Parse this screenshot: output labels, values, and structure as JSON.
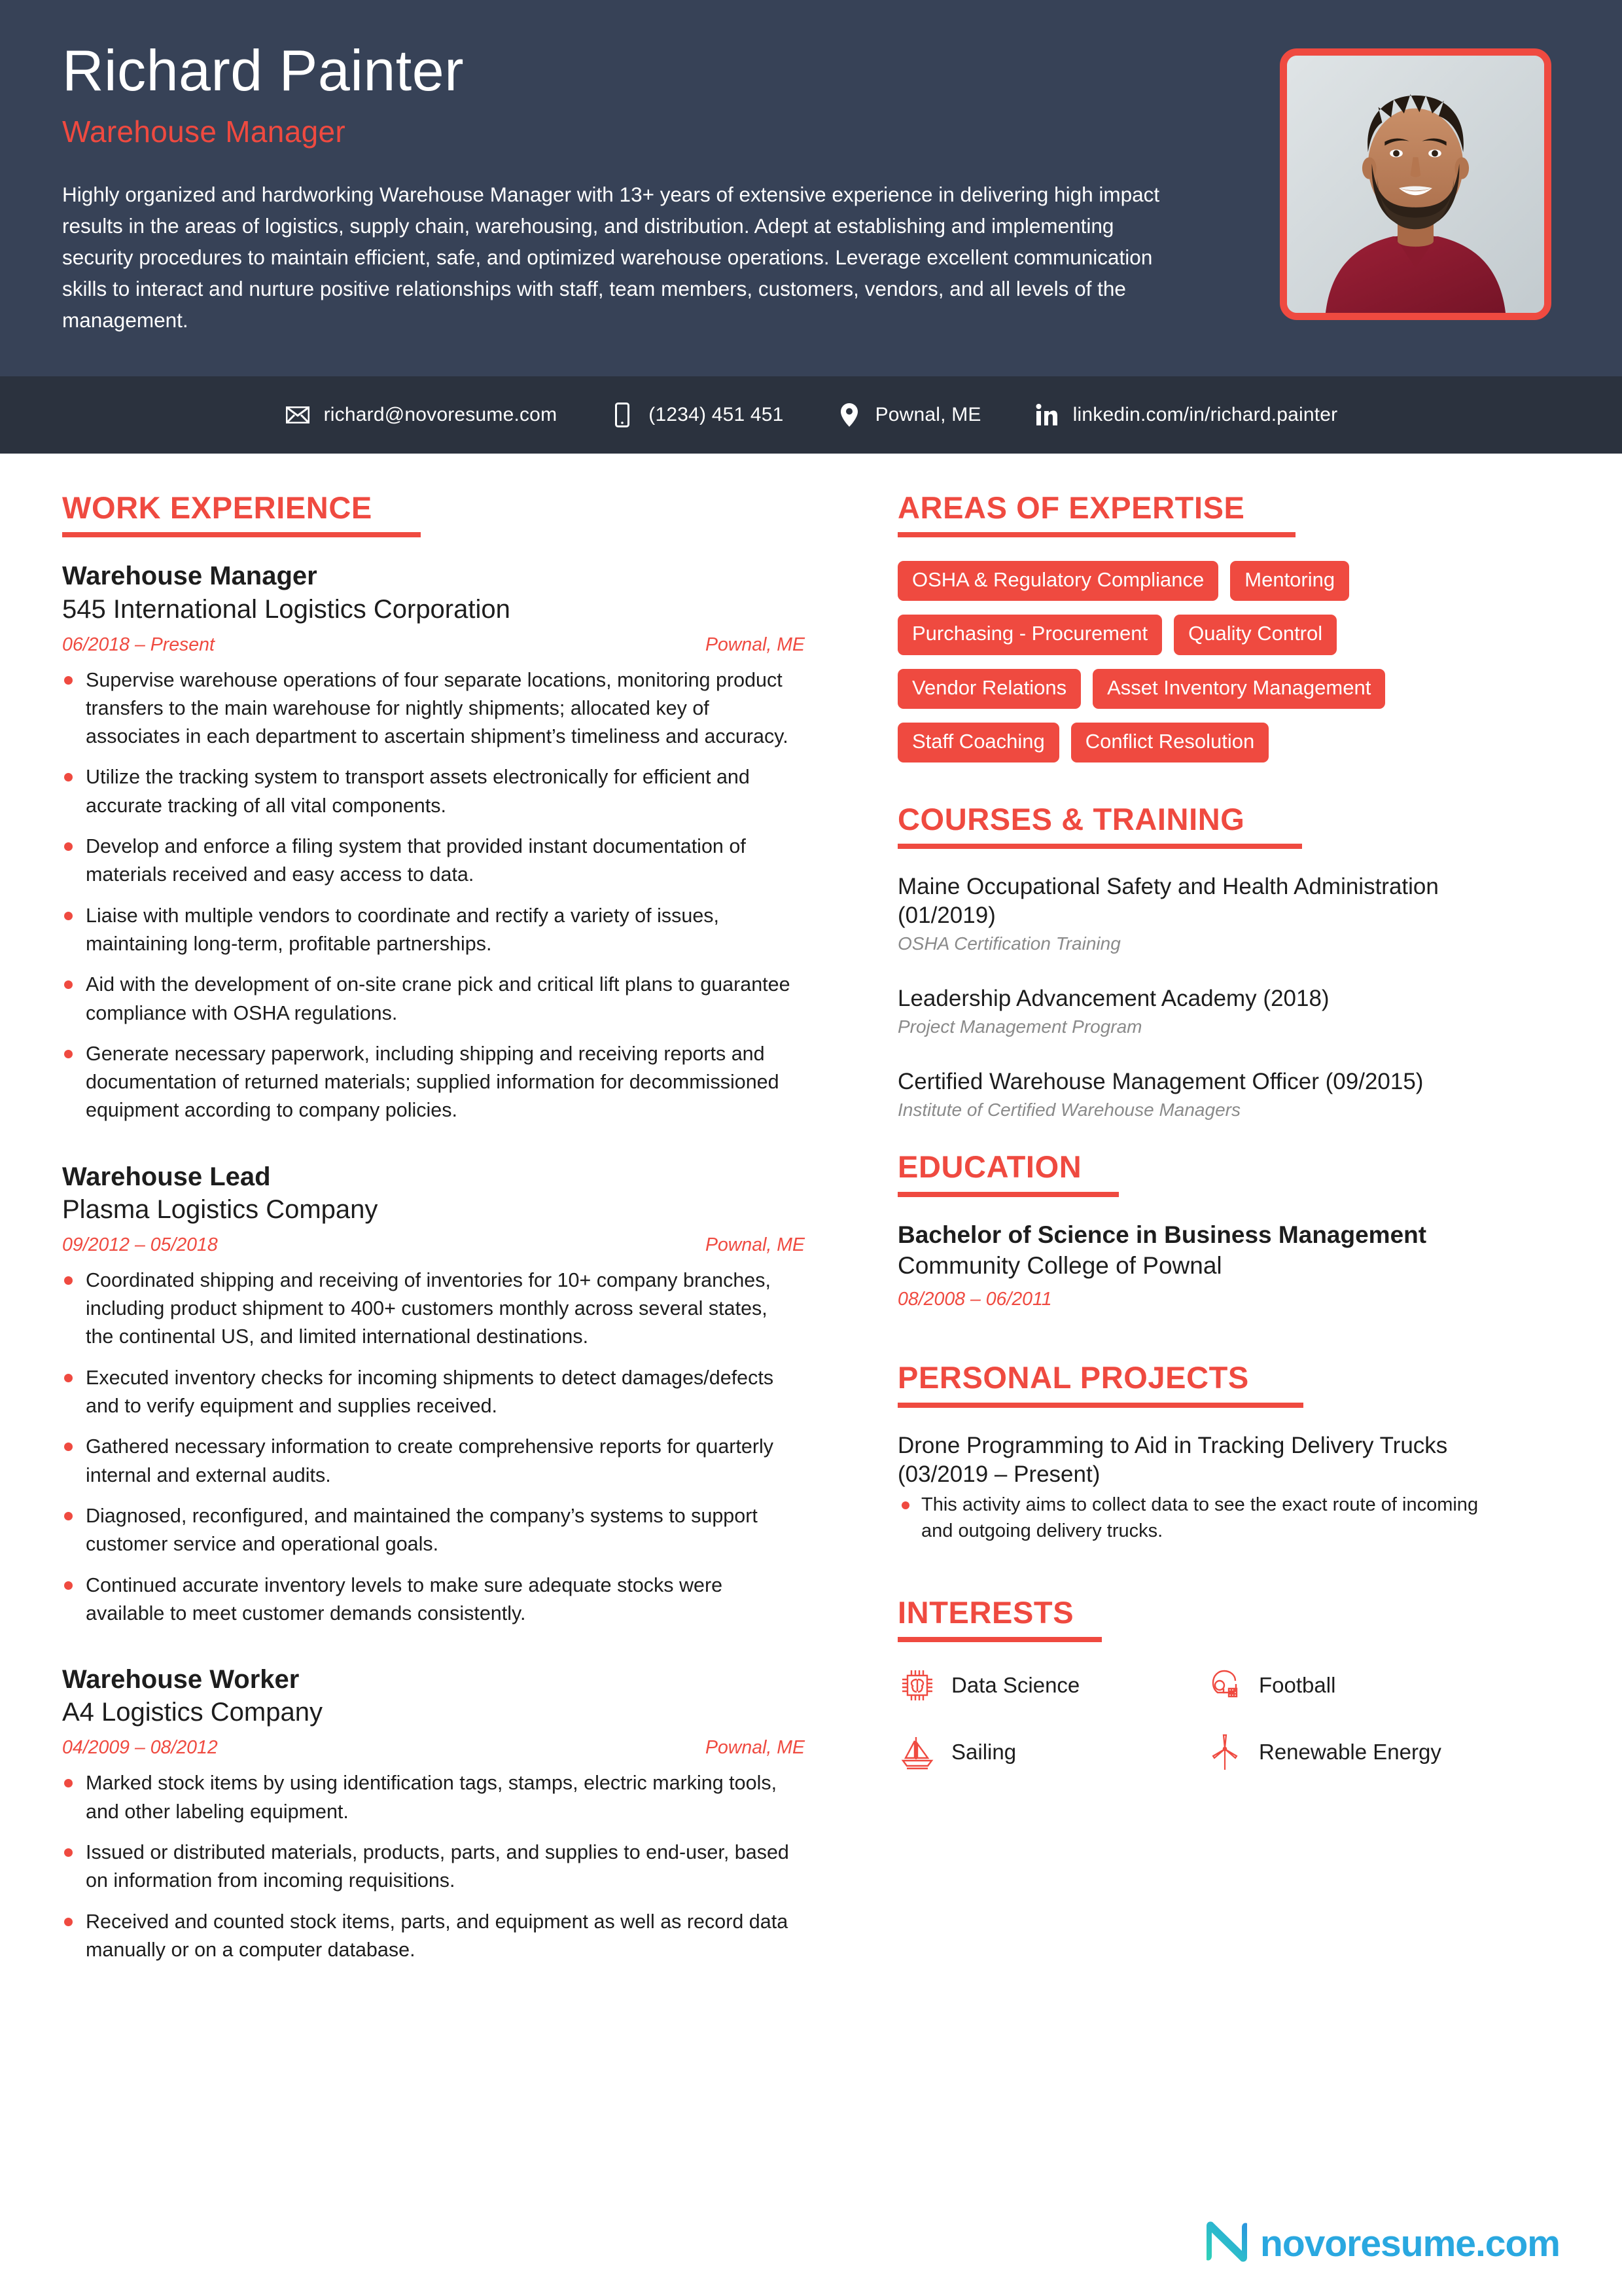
{
  "theme": {
    "accent_red": "#ef4a40",
    "header_bg": "#374257",
    "contact_bar_bg": "#2b323e",
    "text_dark": "#1d1d1d",
    "muted_gray": "#8a8a8a",
    "logo_blue": "#2aa8e0"
  },
  "header": {
    "full_name": "Richard Painter",
    "job_title": "Warehouse Manager",
    "summary": "Highly organized and hardworking Warehouse Manager with 13+ years of extensive experience in delivering high impact results in the areas of logistics, supply chain, warehousing, and distribution. Adept at establishing and implementing security procedures to maintain efficient, safe, and optimized warehouse operations. Leverage excellent communication skills to interact and nurture positive relationships with staff, team members, customers, vendors, and all levels of the management.",
    "photo_alt": "profile-photo"
  },
  "contact": [
    {
      "icon": "envelope-icon",
      "text": "richard@novoresume.com"
    },
    {
      "icon": "phone-icon",
      "text": "(1234) 451 451"
    },
    {
      "icon": "location-pin-icon",
      "text": "Pownal, ME"
    },
    {
      "icon": "linkedin-icon",
      "text": "linkedin.com/in/richard.painter"
    }
  ],
  "work_experience": {
    "title": "WORK EXPERIENCE",
    "jobs": [
      {
        "role": "Warehouse Manager",
        "company": "545 International Logistics Corporation",
        "dates": "06/2018 – Present",
        "location": "Pownal, ME",
        "bullets": [
          "Supervise warehouse operations of four separate locations, monitoring product transfers to the main warehouse for nightly shipments; allocated key of associates in each department to ascertain shipment’s timeliness and accuracy.",
          "Utilize the tracking system to transport assets electronically for efficient and accurate tracking of all vital components.",
          "Develop and enforce a filing system that provided instant documentation of materials received and easy access to data.",
          "Liaise with multiple vendors to coordinate and rectify a variety of issues, maintaining long-term, profitable partnerships.",
          "Aid with the development of on-site crane pick and critical lift plans to guarantee compliance with OSHA regulations.",
          "Generate necessary paperwork, including shipping and receiving reports and documentation of returned materials; supplied information for decommissioned equipment according to company policies."
        ]
      },
      {
        "role": "Warehouse Lead",
        "company": "Plasma Logistics Company",
        "dates": "09/2012 – 05/2018",
        "location": "Pownal, ME",
        "bullets": [
          "Coordinated shipping and receiving of inventories for 10+ company branches, including product shipment to 400+ customers monthly across several states, the continental US, and limited international destinations.",
          "Executed inventory checks for incoming shipments to detect damages/defects and to verify equipment and supplies received.",
          "Gathered necessary information to create comprehensive reports for quarterly internal and external audits.",
          "Diagnosed, reconfigured, and maintained the company’s systems to support customer service and operational goals.",
          "Continued accurate inventory levels to make sure adequate stocks were available to meet customer demands consistently."
        ]
      },
      {
        "role": "Warehouse Worker",
        "company": "A4 Logistics Company",
        "dates": "04/2009 – 08/2012",
        "location": "Pownal, ME",
        "bullets": [
          "Marked stock items by using identification tags, stamps, electric marking tools, and other labeling equipment.",
          "Issued or distributed materials, products, parts, and supplies to end-user, based on information from incoming requisitions.",
          "Received and counted stock items, parts, and equipment as well as record data manually or on a computer database."
        ]
      }
    ]
  },
  "areas_of_expertise": {
    "title": "AREAS OF EXPERTISE",
    "tags": [
      "OSHA & Regulatory Compliance",
      "Mentoring",
      "Purchasing - Procurement",
      "Quality Control",
      "Vendor Relations",
      "Asset Inventory Management",
      "Staff Coaching",
      "Conflict Resolution"
    ]
  },
  "courses_training": {
    "title": "COURSES & TRAINING",
    "items": [
      {
        "name": "Maine Occupational Safety and Health Administration (01/2019)",
        "subtitle": "OSHA Certification Training"
      },
      {
        "name": "Leadership Advancement Academy (2018)",
        "subtitle": "Project Management Program"
      },
      {
        "name": "Certified Warehouse Management Officer (09/2015)",
        "subtitle": "Institute of Certified Warehouse Managers"
      }
    ]
  },
  "education": {
    "title": "EDUCATION",
    "degree": "Bachelor of Science in Business Management",
    "school": "Community College of Pownal",
    "dates": "08/2008 – 06/2011"
  },
  "personal_projects": {
    "title": "PERSONAL PROJECTS",
    "project_title": "Drone Programming to Aid in Tracking Delivery Trucks (03/2019 – Present)",
    "bullets": [
      "This activity aims to collect data to see the exact route of incoming and outgoing delivery trucks."
    ]
  },
  "interests": {
    "title": "INTERESTS",
    "items": [
      {
        "icon": "chip-brain-icon",
        "label": "Data Science"
      },
      {
        "icon": "football-helmet-icon",
        "label": "Football"
      },
      {
        "icon": "sailboat-icon",
        "label": "Sailing"
      },
      {
        "icon": "wind-turbine-icon",
        "label": "Renewable Energy"
      }
    ]
  },
  "footer": {
    "logo_mark": "novoresume-n-icon",
    "logo_text": "novoresume.com"
  }
}
